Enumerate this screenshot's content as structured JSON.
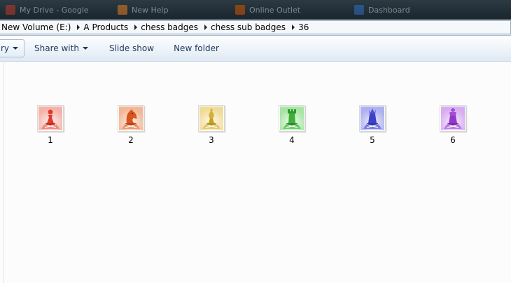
{
  "taskbar": {
    "tasks": [
      {
        "label": "My Drive - Google",
        "color": "#c0392b"
      },
      {
        "label": "New Help",
        "color": "#e67e22"
      },
      {
        "label": "Online Outlet",
        "color": "#d35400"
      },
      {
        "label": "Dashboard",
        "color": "#2e6fbf"
      }
    ]
  },
  "address": {
    "crumbs": [
      "New Volume (E:)",
      "A Products",
      "chess badges",
      "chess sub badges",
      "36"
    ]
  },
  "commandbar": {
    "organize_tail": "ry",
    "share_with": "Share with",
    "slide_show": "Slide show",
    "new_folder": "New folder"
  },
  "files": [
    {
      "name": "1",
      "icon": "pawn-badge-icon",
      "color": "#e03a2e"
    },
    {
      "name": "2",
      "icon": "knight-badge-icon",
      "color": "#d9541e"
    },
    {
      "name": "3",
      "icon": "bishop-badge-icon",
      "color": "#d4b03a"
    },
    {
      "name": "4",
      "icon": "rook-badge-icon",
      "color": "#3fae3a"
    },
    {
      "name": "5",
      "icon": "queen-badge-icon",
      "color": "#4a4fd6"
    },
    {
      "name": "6",
      "icon": "king-badge-icon",
      "color": "#a44ad8"
    }
  ]
}
